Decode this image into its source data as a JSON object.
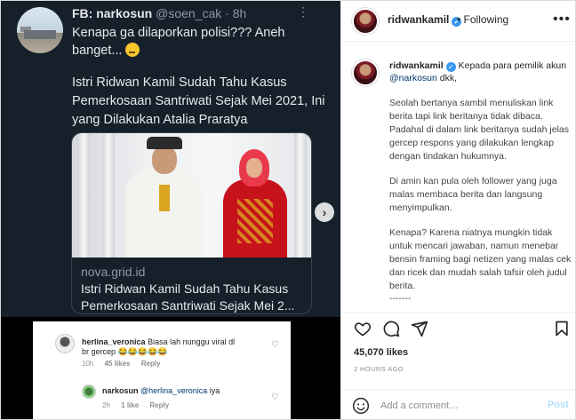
{
  "post": {
    "media": {
      "tweet": {
        "name": "FB: narkosun",
        "handle": "@soen_cak",
        "age": "8h",
        "more": "⋮",
        "text": "Kenapa ga dilaporkan polisi??? Aneh banget...",
        "headline": "Istri Ridwan Kamil Sudah Tahu Kasus Pemerkosaan Santriwati Sejak Mei 2021, Ini yang Dilakukan Atalia Praratya",
        "card_domain": "nova.grid.id",
        "card_title": "Istri Ridwan Kamil Sudah Tahu Kasus\nPemerkosaan Santriwati Sejak Mei 2..."
      },
      "next_icon": "chevron-right",
      "comments": [
        {
          "user": "herlina_veronica",
          "text": "Biasa lah nunggu viral dl",
          "text2": "br gercep 😂😂😂😂😂",
          "age": "10h",
          "likes": "45 likes",
          "reply": "Reply"
        },
        {
          "user": "narkosun",
          "mention": "@herlina_veronica",
          "text": "iya",
          "age": "2h",
          "likes": "1 like",
          "reply": "Reply"
        }
      ]
    },
    "header": {
      "username": "ridwankamil",
      "follow": "• Following",
      "more": "•••"
    },
    "caption": {
      "username": "ridwankamil",
      "intro": "Kepada para pemilik akun",
      "mention": "@narkosun",
      "intro_end": "dkk,",
      "paragraphs": [
        "Seolah bertanya sambil menuliskan link berita tapi link beritanya tidak dibaca. Padahal di dalam link beritanya sudah jelas gercep respons yang dilakukan lengkap dengan tindakan hukumnya.",
        "Di amin kan pula oleh follower yang juga malas membaca berita dan langsung menyimpulkan.",
        "Kenapa? Karena niatnya mungkin tidak untuk mencari jawaban, namun menebar bensin framing bagi netizen yang malas cek dan ricek dan mudah salah tafsir oleh judul berita.",
        "-------"
      ]
    },
    "likes": "45,070 likes",
    "time": "2 HOURS AGO",
    "add_comment": {
      "placeholder": "Add a comment…",
      "post_label": "Post"
    },
    "icons": [
      "heart-icon",
      "comment-icon",
      "share-icon",
      "bookmark-icon",
      "smile-icon",
      "verified-icon"
    ]
  }
}
